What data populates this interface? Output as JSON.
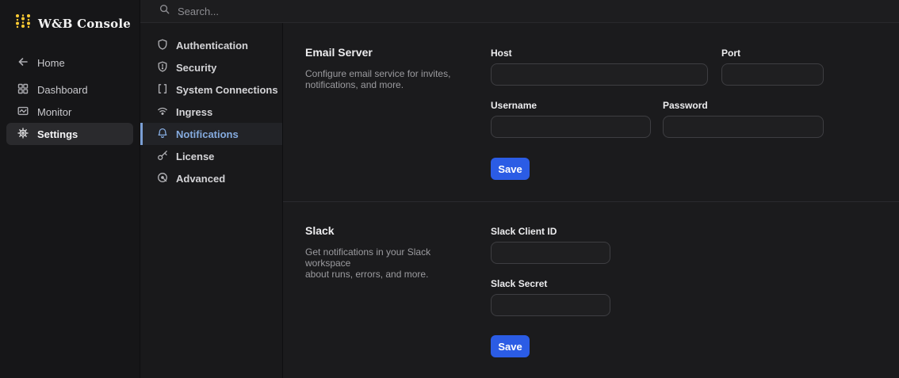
{
  "app": {
    "title": "W&B Console"
  },
  "search": {
    "placeholder": "Search..."
  },
  "sidebar": {
    "items": [
      {
        "label": "Home",
        "icon": "arrow-left-icon",
        "selected": false
      },
      {
        "label": "Dashboard",
        "icon": "dashboard-icon",
        "selected": false
      },
      {
        "label": "Monitor",
        "icon": "monitor-icon",
        "selected": false
      },
      {
        "label": "Settings",
        "icon": "gear-icon",
        "selected": true
      }
    ]
  },
  "settings_nav": {
    "items": [
      {
        "label": "Authentication",
        "icon": "shield-icon",
        "selected": false
      },
      {
        "label": "Security",
        "icon": "shield-alert-icon",
        "selected": false
      },
      {
        "label": "System Connections",
        "icon": "brackets-icon",
        "selected": false
      },
      {
        "label": "Ingress",
        "icon": "wifi-icon",
        "selected": false
      },
      {
        "label": "Notifications",
        "icon": "bell-icon",
        "selected": true
      },
      {
        "label": "License",
        "icon": "key-icon",
        "selected": false
      },
      {
        "label": "Advanced",
        "icon": "advanced-icon",
        "selected": false
      }
    ]
  },
  "sections": [
    {
      "title": "Email Server",
      "description_lines": [
        "Configure email service for invites,",
        "notifications, and more."
      ],
      "fields": [
        {
          "label": "Host",
          "value": ""
        },
        {
          "label": "Port",
          "value": ""
        },
        {
          "label": "Username",
          "value": ""
        },
        {
          "label": "Password",
          "value": ""
        }
      ],
      "save_label": "Save"
    },
    {
      "title": "Slack",
      "description_lines": [
        "Get notifications in your Slack workspace",
        "about runs, errors, and more."
      ],
      "fields": [
        {
          "label": "Slack Client ID",
          "value": ""
        },
        {
          "label": "Slack Secret",
          "value": ""
        }
      ],
      "save_label": "Save"
    }
  ],
  "colors": {
    "accent_blue": "#2b5ce5",
    "selected_nav_blue": "#85abdf",
    "logo_gold": "#ffcc33",
    "background": "#1b1b1d"
  }
}
